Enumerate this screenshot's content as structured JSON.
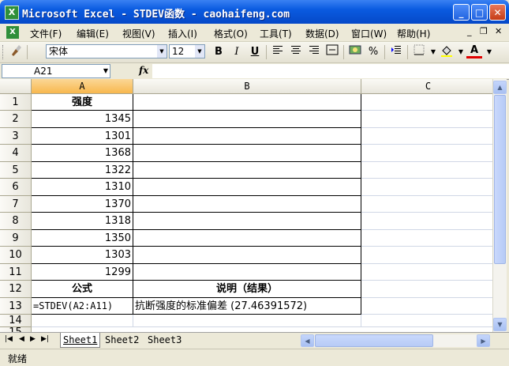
{
  "window": {
    "app_icon_glyph": "X",
    "title": "Microsoft Excel - STDEV函数 - caohaifeng.com",
    "buttons": {
      "minimize": "_",
      "maximize": "□",
      "close": "✕"
    }
  },
  "menu": {
    "items": [
      {
        "name": "menu-file",
        "label": "文件(F)"
      },
      {
        "name": "menu-edit",
        "label": "编辑(E)"
      },
      {
        "name": "menu-view",
        "label": "视图(V)"
      },
      {
        "name": "menu-insert",
        "label": "插入(I)"
      },
      {
        "name": "menu-format",
        "label": "格式(O)"
      },
      {
        "name": "menu-tools",
        "label": "工具(T)"
      },
      {
        "name": "menu-data",
        "label": "数据(D)"
      },
      {
        "name": "menu-window",
        "label": "窗口(W)"
      },
      {
        "name": "menu-help",
        "label": "帮助(H)"
      }
    ],
    "doc_controls": {
      "minimize": "_",
      "restore": "❐",
      "close": "✕"
    }
  },
  "toolbar": {
    "font_name": "宋体",
    "font_size": "12",
    "bold": "B",
    "italic": "I",
    "underline": "U",
    "percent": "%",
    "font_color_glyph": "A"
  },
  "formula_bar": {
    "name_box": "A21",
    "fx_label": "fx",
    "content": ""
  },
  "grid": {
    "columns": [
      "A",
      "B",
      "C"
    ],
    "selected_column": "A",
    "rows": [
      "1",
      "2",
      "3",
      "4",
      "5",
      "6",
      "7",
      "8",
      "9",
      "10",
      "11",
      "12",
      "13",
      "14",
      "15"
    ],
    "selected_row": "",
    "header_row": {
      "A": "强度"
    },
    "values": [
      "1345",
      "1301",
      "1368",
      "1322",
      "1310",
      "1370",
      "1318",
      "1350",
      "1303",
      "1299"
    ],
    "row12": {
      "A": "公式",
      "B": "说明（结果）"
    },
    "row13": {
      "A": "=STDEV(A2:A11)",
      "B": "抗断强度的标准偏差 (27.46391572)"
    }
  },
  "sheets": {
    "tabs": [
      "Sheet1",
      "Sheet2",
      "Sheet3"
    ],
    "active": "Sheet1"
  },
  "status": {
    "text": "就绪"
  }
}
